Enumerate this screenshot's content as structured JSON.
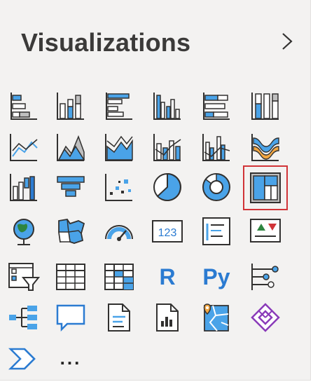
{
  "pane": {
    "title": "Visualizations",
    "expand_icon": "chevron-right-icon"
  },
  "colors": {
    "blue": "#4aa3e8",
    "dark_blue": "#2b7bd1",
    "gray": "#8a8886",
    "stroke": "#323130",
    "selection_outline": "#d13438"
  },
  "visuals": [
    {
      "icon": "stacked-bar-chart-icon"
    },
    {
      "icon": "stacked-column-chart-icon"
    },
    {
      "icon": "clustered-bar-chart-icon"
    },
    {
      "icon": "clustered-column-chart-icon"
    },
    {
      "icon": "100-percent-stacked-bar-chart-icon"
    },
    {
      "icon": "100-percent-stacked-column-chart-icon"
    },
    {
      "icon": "line-chart-icon"
    },
    {
      "icon": "area-chart-icon"
    },
    {
      "icon": "stacked-area-chart-icon"
    },
    {
      "icon": "line-and-stacked-column-chart-icon"
    },
    {
      "icon": "line-and-clustered-column-chart-icon"
    },
    {
      "icon": "ribbon-chart-icon"
    },
    {
      "icon": "waterfall-chart-icon"
    },
    {
      "icon": "funnel-chart-icon"
    },
    {
      "icon": "scatter-chart-icon"
    },
    {
      "icon": "pie-chart-icon"
    },
    {
      "icon": "donut-chart-icon"
    },
    {
      "icon": "treemap-icon",
      "selected": true
    },
    {
      "icon": "map-icon"
    },
    {
      "icon": "filled-map-icon"
    },
    {
      "icon": "gauge-icon"
    },
    {
      "icon": "card-icon",
      "label": "123"
    },
    {
      "icon": "multi-row-card-icon"
    },
    {
      "icon": "kpi-icon"
    },
    {
      "icon": "slicer-icon"
    },
    {
      "icon": "table-icon"
    },
    {
      "icon": "matrix-icon"
    },
    {
      "icon": "r-script-visual-icon",
      "label": "R"
    },
    {
      "icon": "python-visual-icon",
      "label": "Py"
    },
    {
      "icon": "key-influencers-icon"
    },
    {
      "icon": "decomposition-tree-icon"
    },
    {
      "icon": "qa-icon"
    },
    {
      "icon": "smart-narrative-icon"
    },
    {
      "icon": "paginated-report-icon"
    },
    {
      "icon": "arcgis-map-icon"
    },
    {
      "icon": "power-apps-icon"
    },
    {
      "icon": "power-automate-icon"
    },
    {
      "icon": "more-visuals-icon",
      "label": "..."
    }
  ]
}
